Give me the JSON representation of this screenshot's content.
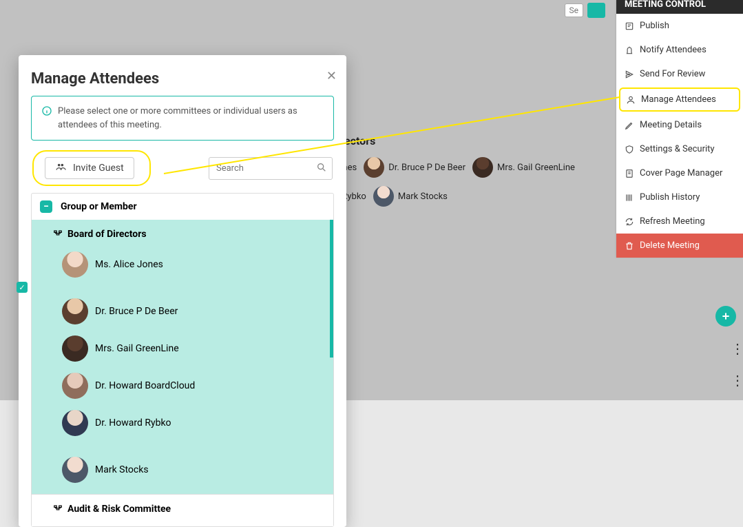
{
  "top_stub": {
    "se": "Se"
  },
  "right_panel": {
    "header": "MEETING CONTROL",
    "publish": "Publish",
    "notify": "Notify Attendees",
    "send_review": "Send For Review",
    "manage_attendees": "Manage Attendees",
    "meeting_details": "Meeting Details",
    "settings_security": "Settings & Security",
    "cover_page": "Cover Page Manager",
    "publish_history": "Publish History",
    "refresh": "Refresh Meeting",
    "delete": "Delete Meeting"
  },
  "background": {
    "heading_suffix": "ectors",
    "row1": [
      {
        "suffix": "ones"
      },
      {
        "name": "Dr. Bruce P De Beer"
      },
      {
        "name": "Mrs. Gail GreenLine"
      }
    ],
    "row2": [
      {
        "suffix": "l Rybko"
      },
      {
        "name": "Mark Stocks"
      }
    ]
  },
  "modal": {
    "title": "Manage Attendees",
    "info": "Please select one or more committees or individual users as attendees of this meeting.",
    "invite_label": "Invite Guest",
    "search_placeholder": "Search",
    "list_header": "Group or Member",
    "groups": [
      {
        "id": "board",
        "name": "Board of Directors",
        "selected": true,
        "members": [
          {
            "name": "Ms. Alice Jones"
          },
          {
            "name": "Dr. Bruce P De Beer"
          },
          {
            "name": "Mrs. Gail GreenLine"
          },
          {
            "name": "Dr. Howard BoardCloud"
          },
          {
            "name": "Dr. Howard Rybko"
          },
          {
            "name": "Mark Stocks"
          }
        ]
      },
      {
        "id": "audit",
        "name": "Audit & Risk Committee",
        "selected": false,
        "members": []
      }
    ]
  }
}
